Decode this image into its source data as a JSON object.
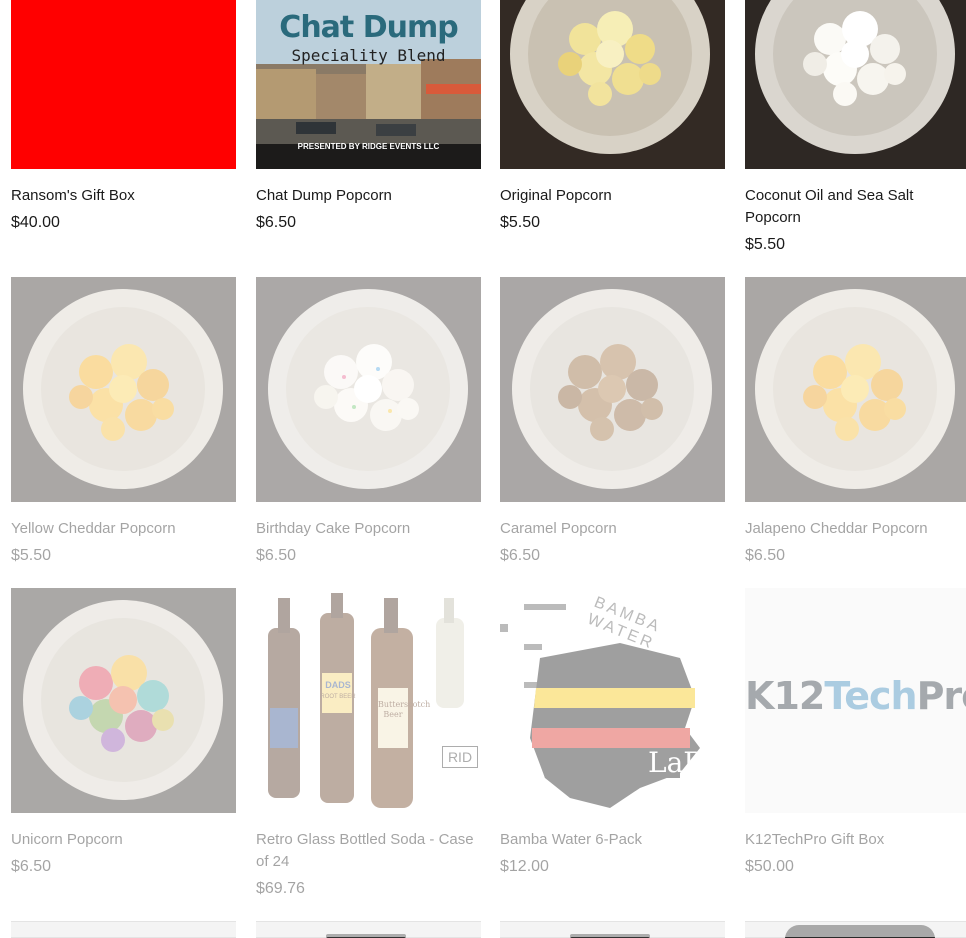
{
  "products": [
    {
      "name": "Ransom's Gift Box",
      "price": "$40.00"
    },
    {
      "name": "Chat Dump Popcorn",
      "price": "$6.50"
    },
    {
      "name": "Original Popcorn",
      "price": "$5.50"
    },
    {
      "name": "Coconut Oil and Sea Salt Popcorn",
      "price": "$5.50"
    },
    {
      "name": "Yellow Cheddar Popcorn",
      "price": "$5.50"
    },
    {
      "name": "Birthday Cake Popcorn",
      "price": "$6.50"
    },
    {
      "name": "Caramel Popcorn",
      "price": "$6.50"
    },
    {
      "name": "Jalapeno Cheddar Popcorn",
      "price": "$6.50"
    },
    {
      "name": "Unicorn Popcorn",
      "price": "$6.50"
    },
    {
      "name": "Retro Glass Bottled Soda - Case of 24",
      "price": "$69.76"
    },
    {
      "name": "Bamba Water 6-Pack",
      "price": "$12.00"
    },
    {
      "name": "K12TechPro Gift Box",
      "price": "$50.00"
    }
  ],
  "images": {
    "chat_dump": {
      "title": "Chat Dump",
      "subtitle": "Speciality Blend",
      "credit": "PRESENTED BY RIDGE EVENTS LLC"
    },
    "soda": {
      "label_dads": "DADS",
      "label_dads_sub": "ROOT BEER",
      "label_butterscotch": "Butterscotch Beer",
      "label_rid": "RID"
    },
    "bamba": {
      "arc_text": "BAMBA WATER",
      "logo_text": "LaR"
    },
    "k12": {
      "part1": "K12",
      "part2": "Tech",
      "part3": "Pro"
    }
  },
  "colors": {
    "red_box": "#ff0000",
    "bowl": "#e8e4dc",
    "dark_bg": "#3a2f28",
    "k12_dark": "#1f2a33",
    "k12_blue": "#2f7fb5"
  }
}
